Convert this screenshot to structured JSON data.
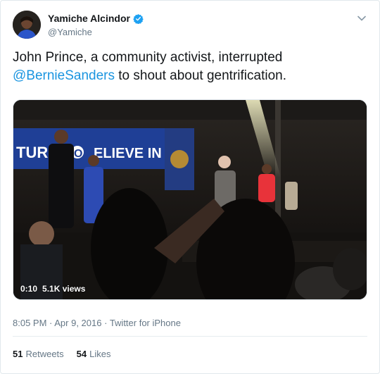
{
  "author": {
    "name": "Yamiche Alcindor",
    "handle": "@Yamiche",
    "verified": true
  },
  "tweet": {
    "text_line1": "John Prince, a community activist, interrupted",
    "mention": "@BernieSanders",
    "text_after_mention": " to shout about gentrification."
  },
  "media": {
    "type": "video",
    "duration": "0:10",
    "views": "5.1K views",
    "banner_text_left": "TURE",
    "banner_text_mid": "O",
    "banner_text_right": "ELIEVE IN"
  },
  "meta": {
    "time": "8:05 PM",
    "separator1": " · ",
    "date": "Apr 9, 2016",
    "separator2": " · ",
    "source": "Twitter for iPhone"
  },
  "stats": {
    "retweets_count": "51",
    "retweets_label": "Retweets",
    "likes_count": "54",
    "likes_label": "Likes"
  },
  "icons": {
    "verified": "verified-badge-icon",
    "caret": "chevron-down-icon"
  },
  "colors": {
    "link": "#1b95e0",
    "verified": "#1da1f2",
    "secondary_text": "#657786"
  }
}
